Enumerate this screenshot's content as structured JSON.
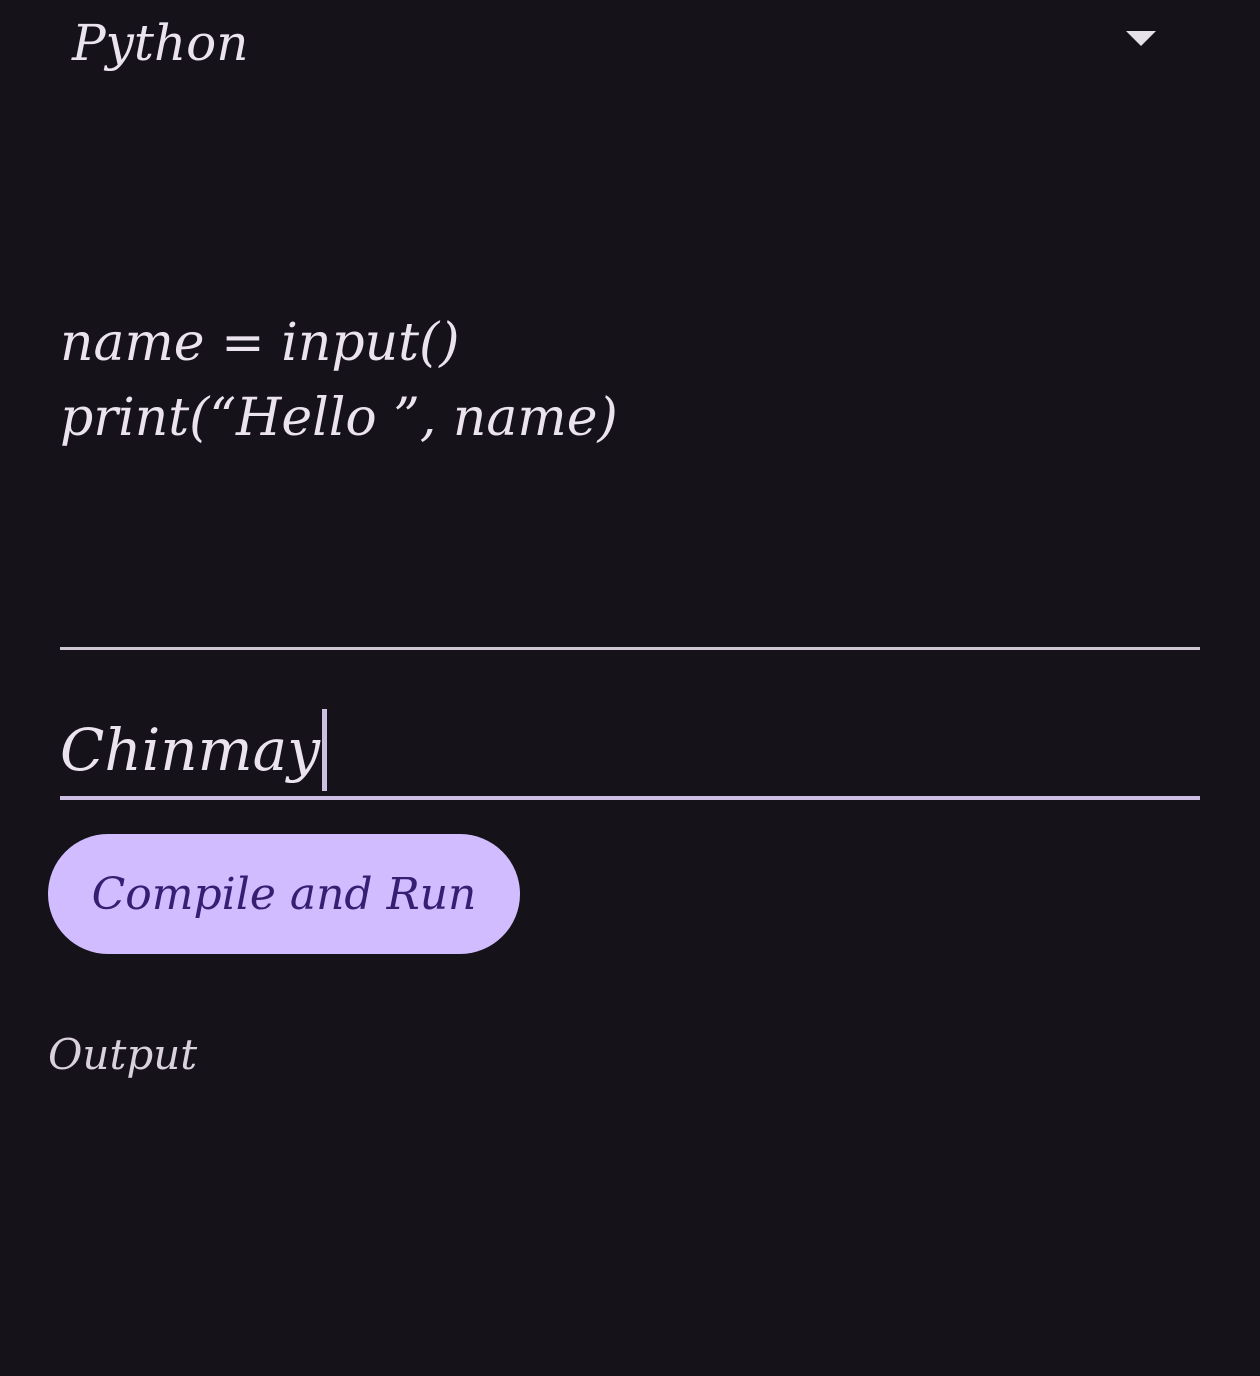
{
  "language_select": {
    "selected": "Python",
    "arrow_icon": "dropdown-triangle-icon"
  },
  "editor": {
    "code": "name = input()\nprint(“Hello ”, name)"
  },
  "stdin": {
    "value": "Chinmay"
  },
  "actions": {
    "run_label": "Compile and Run"
  },
  "output": {
    "label": "Output"
  },
  "colors": {
    "background": "#151219",
    "accent": "#d0bcfe",
    "button_text": "#381e72",
    "text": "#ebe3ee",
    "underline": "#cdbfe3"
  }
}
